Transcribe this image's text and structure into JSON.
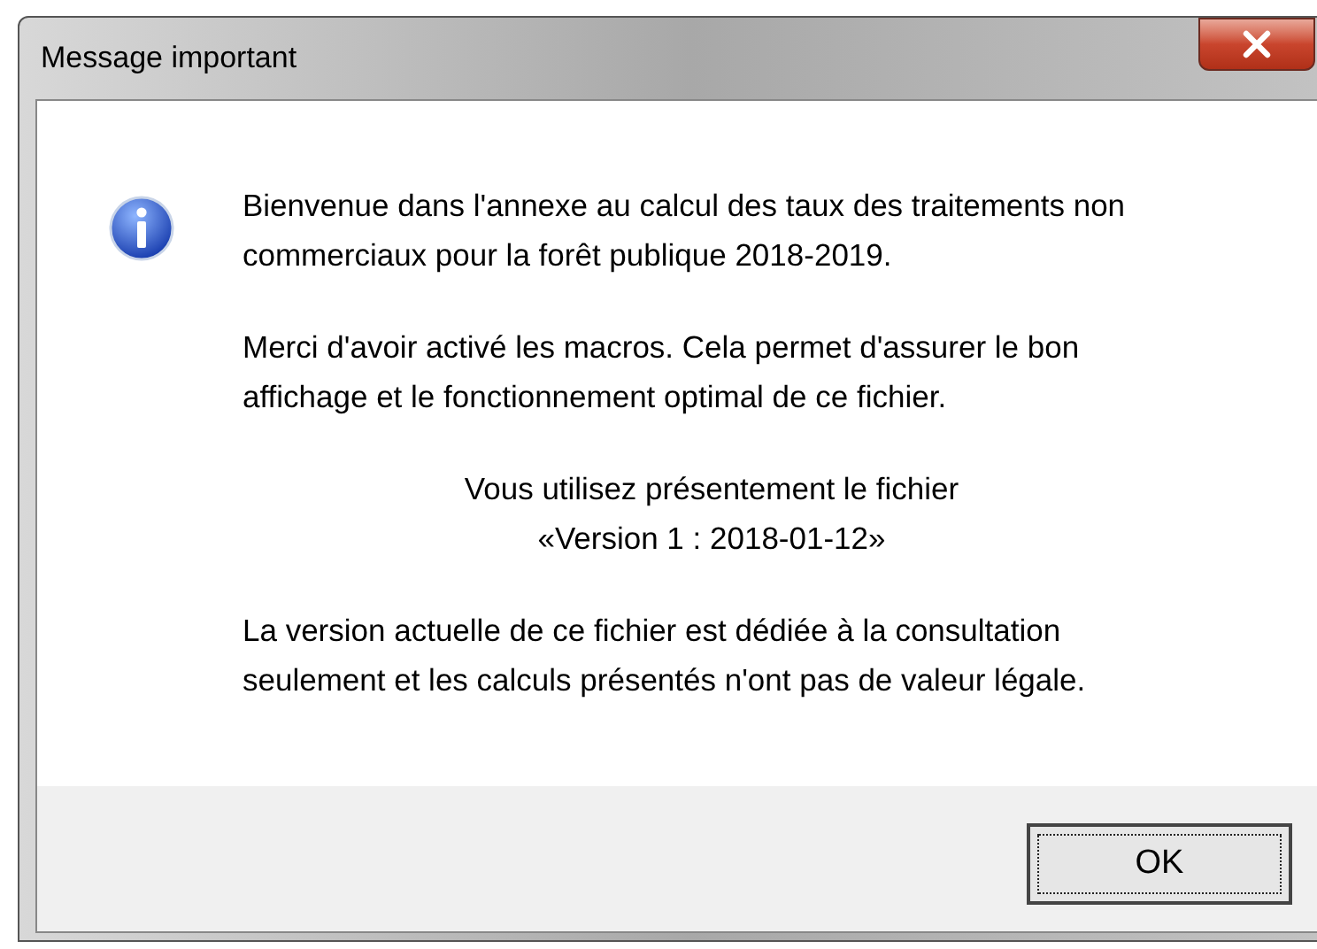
{
  "window": {
    "title": "Message important"
  },
  "paragraphs": [
    {
      "kind": "left",
      "lines": [
        "Bienvenue dans l'annexe au calcul des taux des traitements non",
        "commerciaux pour la forêt publique 2018-2019."
      ]
    },
    {
      "kind": "left",
      "lines": [
        "Merci d'avoir activé les macros. Cela permet d'assurer le bon",
        "affichage et le fonctionnement optimal de ce fichier."
      ]
    },
    {
      "kind": "center",
      "lines": [
        "Vous utilisez présentement le fichier",
        "«Version 1 : 2018-01-12»"
      ]
    },
    {
      "kind": "left",
      "lines": [
        "La version actuelle de ce fichier est dédiée à la consultation",
        "seulement et les calculs présentés n'ont pas de valeur légale."
      ]
    }
  ],
  "buttons": [
    {
      "label": "OK",
      "focused": true
    }
  ]
}
